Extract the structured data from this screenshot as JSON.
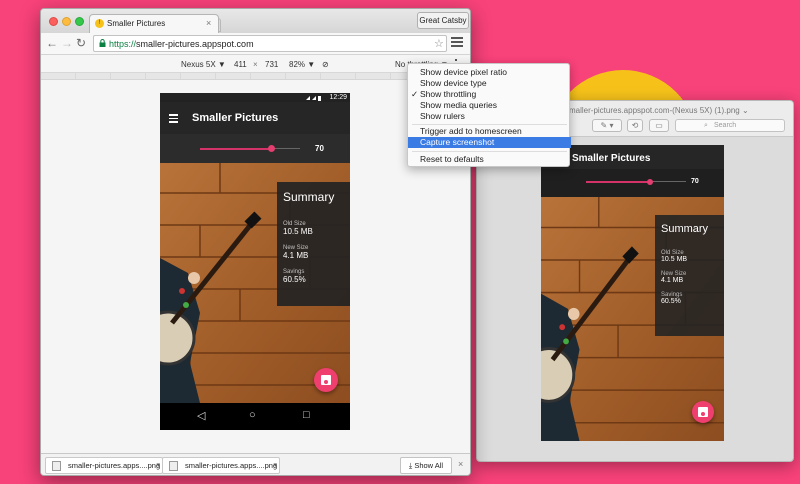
{
  "browser": {
    "tab_title": "Smaller Pictures",
    "profile_name": "Great Catsby",
    "url_scheme": "https://",
    "url_rest": "smaller-pictures.appspot.com"
  },
  "device_toolbar": {
    "device": "Nexus 5X",
    "width": "411",
    "times": "×",
    "height": "731",
    "zoom": "82%",
    "throttling": "No throttling"
  },
  "settings_menu": {
    "items": [
      {
        "label": "Show device pixel ratio",
        "checked": false
      },
      {
        "label": "Show device type",
        "checked": false
      },
      {
        "label": "Show throttling",
        "checked": true
      },
      {
        "label": "Show media queries",
        "checked": false
      },
      {
        "label": "Show rulers",
        "checked": false
      },
      {
        "label": "Trigger add to homescreen",
        "checked": false
      },
      {
        "label": "Capture screenshot",
        "checked": false,
        "highlighted": true
      },
      {
        "label": "Reset to defaults",
        "checked": false
      }
    ],
    "checkmark": "✓"
  },
  "app": {
    "status_time": "12:29",
    "title": "Smaller Pictures",
    "slider_value": "70",
    "slider_fraction": 0.7,
    "summary_title": "Summary",
    "stats": [
      {
        "label": "Old Size",
        "value": "10.5 MB"
      },
      {
        "label": "New Size",
        "value": "4.1 MB"
      },
      {
        "label": "Savings",
        "value": "60.5%"
      }
    ],
    "nav_keys": [
      "◁",
      "○",
      "□"
    ]
  },
  "downloads": {
    "items": [
      "smaller-pictures.apps....png",
      "smaller-pictures.apps....png"
    ],
    "show_all_label": "Show All"
  },
  "preview": {
    "window_title": "smaller-pictures.appspot.com-(Nexus 5X) (1).png ⌄",
    "search_placeholder": "Search",
    "app_title": "Smaller Pictures",
    "slider_value": "70",
    "summary_title": "Summary",
    "stats": [
      {
        "label": "Old Size",
        "value": "10.5 MB"
      },
      {
        "label": "New Size",
        "value": "4.1 MB"
      },
      {
        "label": "Savings",
        "value": "60.5%"
      }
    ]
  },
  "colors": {
    "background": "#f8427a",
    "accent": "#ee3f6f",
    "menu_highlight": "#3a7be4",
    "app_bar": "#262626"
  }
}
